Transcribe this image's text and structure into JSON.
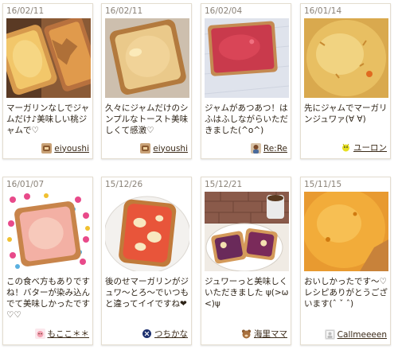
{
  "cards": [
    {
      "date": "16/02/11",
      "comment": "マーガリンなしでジャムだけ♪美味しい桃ジャムで♡",
      "author": "eiyoushi",
      "avatar_icon": "food-photo-avatar-icon",
      "photo_icon": "toast-with-peach-jam-photo"
    },
    {
      "date": "16/02/11",
      "comment": "久々にジャムだけのシンプルなトースト美味しくて感激♡",
      "author": "eiyoushi",
      "avatar_icon": "food-photo-avatar-icon",
      "photo_icon": "toast-with-jam-photo"
    },
    {
      "date": "16/02/04",
      "comment": "ジャムがあつあつ！はふはふしながらいただきました(^o^)",
      "author": "Re:Re",
      "avatar_icon": "person-avatar-icon",
      "photo_icon": "toast-with-strawberry-jam-on-napkin-photo"
    },
    {
      "date": "16/01/14",
      "comment": "先にジャムでマーガリンジュワァ(∀ ∀)",
      "author": "ユーロン",
      "avatar_icon": "yellow-creature-avatar-icon",
      "photo_icon": "toast-closeup-photo"
    },
    {
      "date": "16/01/07",
      "comment": "この食べ方もありですね！バターが染み込んでて美味しかったです♡♡",
      "author": "もここ＊＊",
      "avatar_icon": "pink-character-avatar-icon",
      "photo_icon": "toast-on-polka-dot-plate-photo"
    },
    {
      "date": "15/12/26",
      "comment": "後のせマーガリンがジュワ〜とろ〜でいつもと違ってイイですね❤",
      "author": "つちかな",
      "avatar_icon": "blue-circle-avatar-icon",
      "photo_icon": "toast-with-jam-on-plate-photo"
    },
    {
      "date": "15/12/21",
      "comment": "ジュワーっと美味しくいただきました ψ(>ω<)ψ",
      "author": "海里ママ",
      "avatar_icon": "bear-avatar-icon",
      "photo_icon": "toast-slices-with-coffee-photo"
    },
    {
      "date": "15/11/15",
      "comment": "おいしかったです〜♡レシピありがとうございます(ˆ ˇ ˆ)",
      "author": "Callmeeeen",
      "avatar_icon": "gray-avatar-icon",
      "photo_icon": "toast-closeup-orange-jam-photo"
    }
  ],
  "colors": {
    "card_border": "#e4ddd0",
    "date_text": "#8a8278",
    "comment_text": "#2e2418"
  }
}
